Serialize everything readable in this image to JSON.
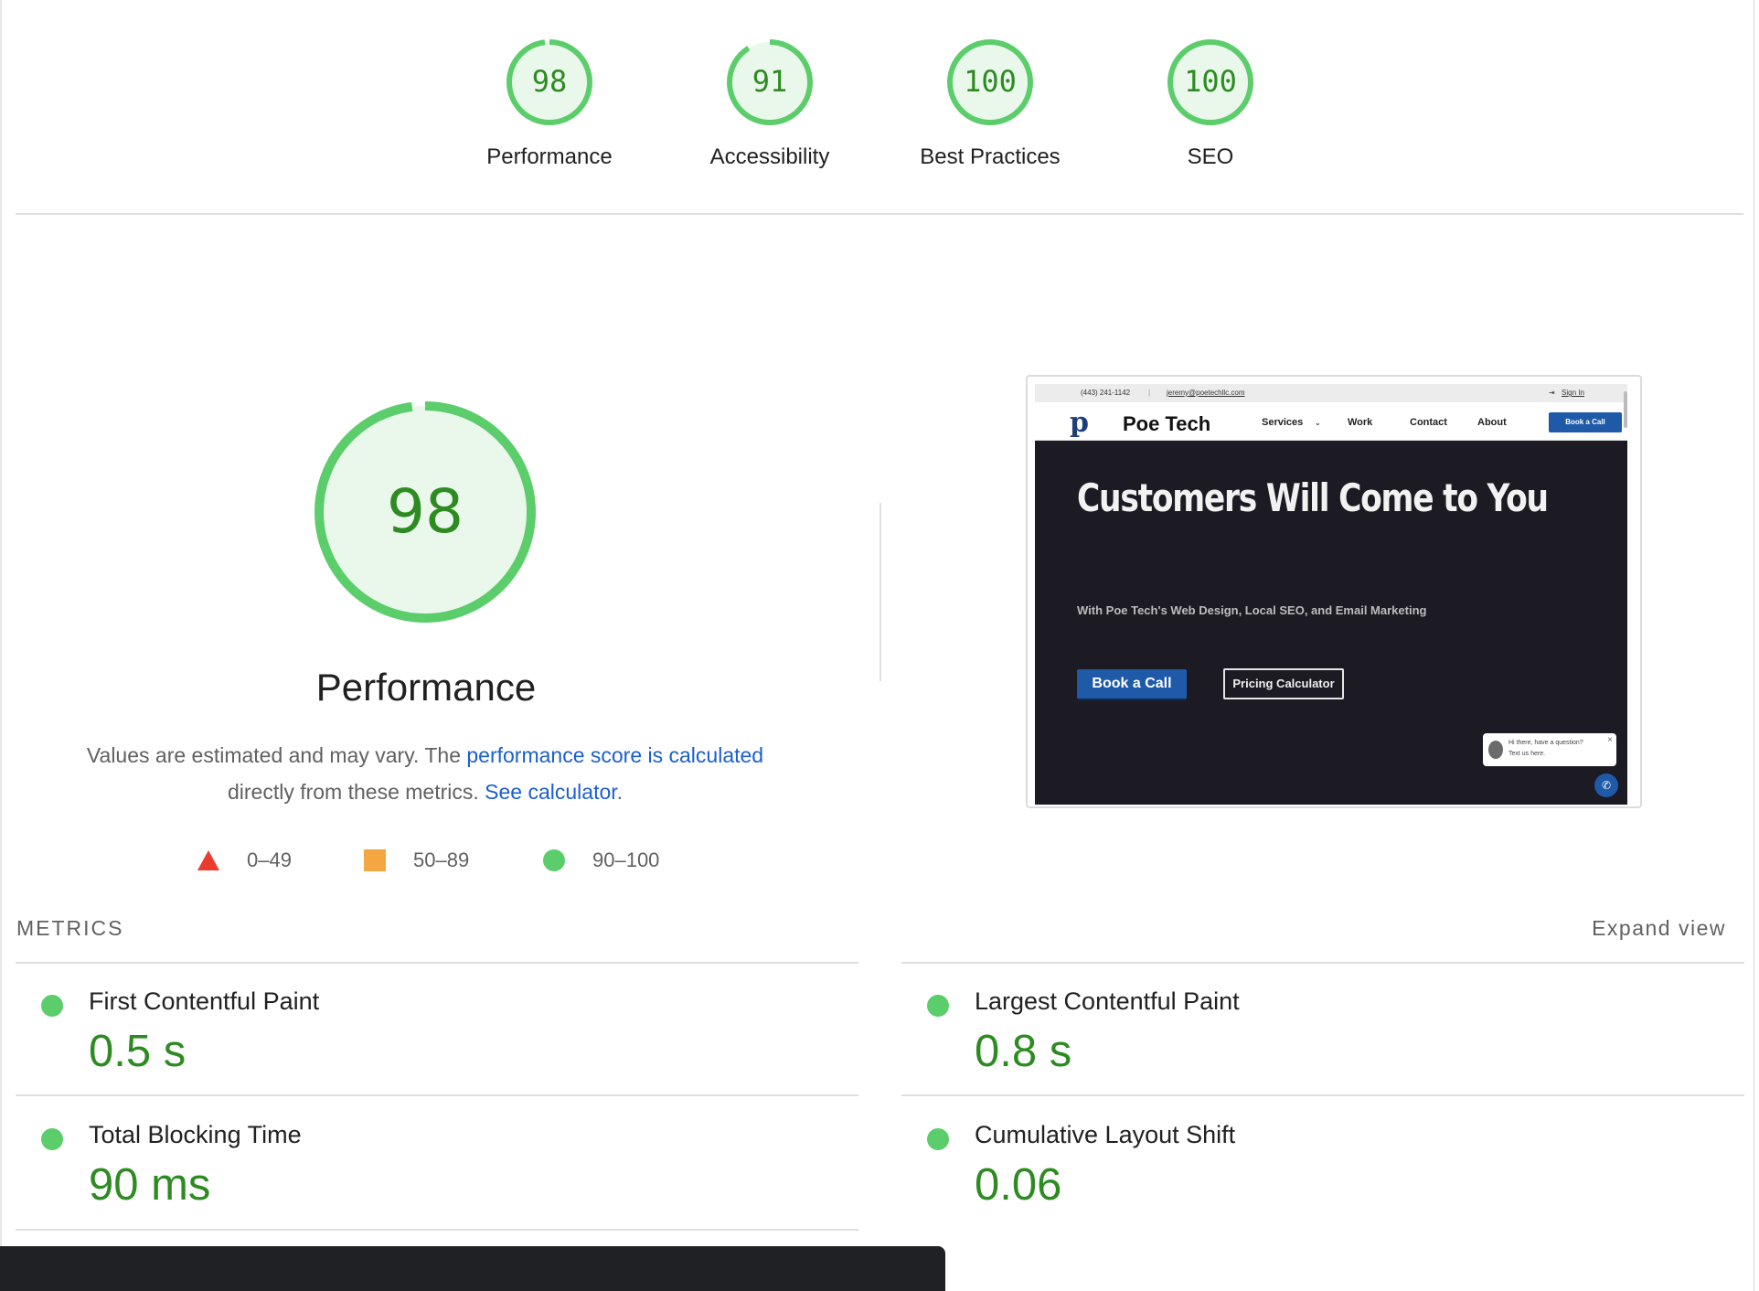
{
  "categories": [
    {
      "score": "98",
      "label": "Performance",
      "fraction": 0.98
    },
    {
      "score": "91",
      "label": "Accessibility",
      "fraction": 0.91
    },
    {
      "score": "100",
      "label": "Best Practices",
      "fraction": 1.0
    },
    {
      "score": "100",
      "label": "SEO",
      "fraction": 1.0
    }
  ],
  "performance": {
    "score": "98",
    "fraction": 0.98,
    "title": "Performance",
    "desc_prefix": "Values are estimated and may vary. The ",
    "desc_link1": "performance score is calculated",
    "desc_middle": " directly from these metrics. ",
    "desc_link2": "See calculator",
    "desc_suffix": "."
  },
  "legend": [
    {
      "range": "0–49",
      "shape": "triangle",
      "color": "#eb3b2f"
    },
    {
      "range": "50–89",
      "shape": "square",
      "color": "#f4a641"
    },
    {
      "range": "90–100",
      "shape": "circle",
      "color": "#5ccd6b"
    }
  ],
  "screenshot": {
    "phone": "(443) 241-1142",
    "email": "jeremy@poetechllc.com",
    "sign_in": "Sign In",
    "logo_mark": "p",
    "logo_text": "Poe Tech",
    "nav": [
      "Services",
      "Work",
      "Contact",
      "About"
    ],
    "nav_button": "Book a Call",
    "hero_title": "Customers Will Come to You",
    "hero_sub": "With Poe Tech's Web Design, Local SEO, and Email Marketing",
    "btn_primary": "Book a Call",
    "btn_secondary": "Pricing Calculator",
    "chat_line1": "Hi there, have a question?",
    "chat_line2": "Text us here."
  },
  "metrics": {
    "heading": "METRICS",
    "expand": "Expand view",
    "items": [
      {
        "name": "First Contentful Paint",
        "value": "0.5 s"
      },
      {
        "name": "Largest Contentful Paint",
        "value": "0.8 s"
      },
      {
        "name": "Total Blocking Time",
        "value": "90 ms"
      },
      {
        "name": "Cumulative Layout Shift",
        "value": "0.06"
      }
    ]
  },
  "colors": {
    "pass": "#5ccd6b",
    "pass_fill": "#eaf8ec",
    "pass_text": "#2e8b22",
    "link": "#1a5fd0"
  }
}
